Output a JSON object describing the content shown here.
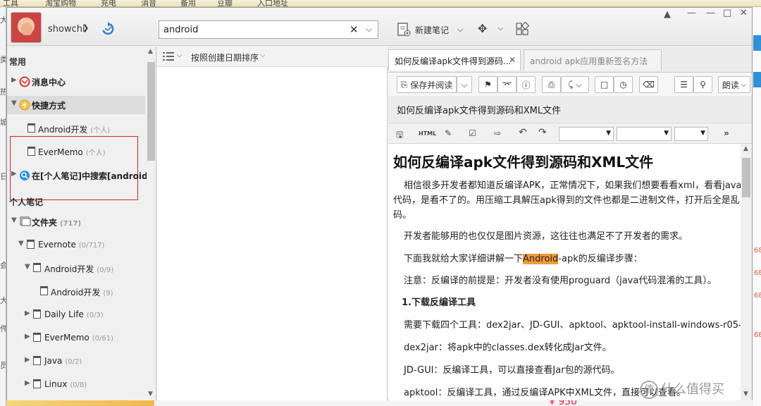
{
  "background": {
    "bookmarks": [
      "工具",
      "淘宝购物",
      "充电",
      "消音",
      "备用",
      "豆瓣",
      "入口地址"
    ],
    "left_fragments": [
      "大",
      "类",
      "热",
      "城",
      "日",
      "会",
      "大",
      "件",
      "员"
    ],
    "right_fragments": [
      "68",
      "68",
      "68",
      "68"
    ],
    "bottom_price": "¥ 950"
  },
  "titlebar": {
    "username": "showchi",
    "search_value": "android",
    "new_note_label": "新建笔记",
    "window_controls": [
      "minimize-to-tray",
      "minimize",
      "maximize",
      "close"
    ]
  },
  "left": {
    "section_common": "常用",
    "message_center": "消息中心",
    "shortcuts": "快捷方式",
    "shortcut_items": [
      {
        "label": "Android开发",
        "tag": "(个人)"
      },
      {
        "label": "EverMemo",
        "tag": "(个人)"
      }
    ],
    "search_in": "在[个人笔记]中搜索[android]",
    "section_personal": "个人笔记",
    "folders": [
      {
        "label": "文件夹",
        "count": "(717)",
        "level": 0
      },
      {
        "label": "Evernote",
        "count": "(0/717)",
        "level": 1
      },
      {
        "label": "Android开发",
        "count": "(0/9)",
        "level": 2
      },
      {
        "label": "Android开发",
        "count": "(9)",
        "level": 3
      },
      {
        "label": "Daily Life",
        "count": "(0/3)",
        "level": 2
      },
      {
        "label": "EverMemo",
        "count": "(0/61)",
        "level": 2
      },
      {
        "label": "Java",
        "count": "(0/2)",
        "level": 2
      },
      {
        "label": "Linux",
        "count": "(0/8)",
        "level": 2
      }
    ]
  },
  "middle": {
    "sort_label": "按照创建日期排序"
  },
  "right": {
    "tabs": [
      {
        "label": "如何反编译apk文件得到源码...",
        "active": true
      },
      {
        "label": "android apk应用重新签名方法",
        "active": false
      }
    ],
    "save_read_label": "保存并阅读",
    "read_aloud_label": "朗读",
    "note_title": "如何反编译apk文件得到源码和XML文件",
    "html_label": "HTML",
    "doc": {
      "heading": "如何反编译apk文件得到源码和XML文件",
      "p1a": "相信很多开发者都知道反编译APK，正常情况下，如果我们想要看看xml，看看java源",
      "p1b": "代码，是看不了的。用压缩工具解压apk得到的文件也都是二进制文件，打开后全是乱",
      "p1c": "码。",
      "p2": "开发者能够用的也仅仅是图片资源，这往往也满足不了开发者的需求。",
      "p3_pre": "下面我就给大家详细讲解一下",
      "p3_hl": "Android",
      "p3_post": "-apk的反编译步骤：",
      "p4": "注意：反编译的前提是：开发者没有使用proguard（java代码混淆的工具）。",
      "h2": "1.下载反编译工具",
      "p5": "需要下载四个工具：dex2jar、JD-GUI、apktool、apktool-install-windows-r05-ibot",
      "p6": "dex2jar：将apk中的classes.dex转化成Jar文件。",
      "p7": "JD-GUI：反编译工具，可以直接查看Jar包的源代码。",
      "p8": "apktool：反编译工具，通过反编译APK中XML文件，直接可以查看。"
    }
  },
  "watermark": "什么值得买",
  "colors": {
    "highlight": "#f29a3a",
    "red_box": "#e02020",
    "sync_blue": "#2b7fd6"
  }
}
